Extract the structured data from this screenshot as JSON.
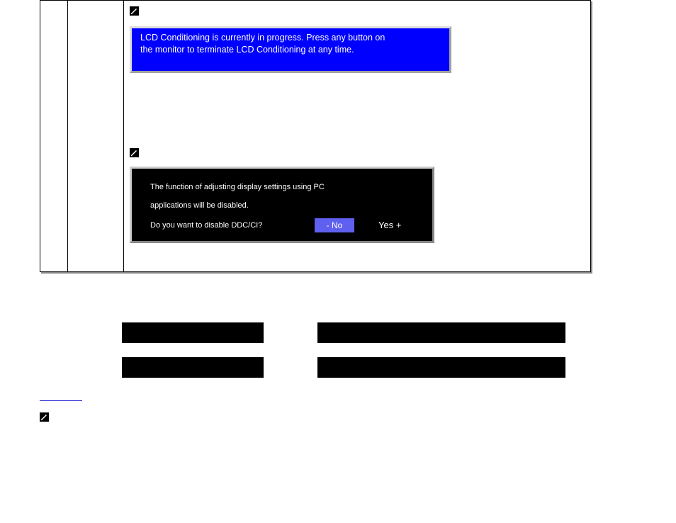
{
  "blue_message": {
    "line1": "LCD Conditioning is currently in progress.  Press any button on",
    "line2": "the monitor to terminate LCD Conditioning at any time."
  },
  "ddc_dialog": {
    "line1": "The function of adjusting display settings using PC",
    "line2": "applications will be disabled.",
    "question": "Do you want to disable DDC/CI?",
    "no_label": "- No",
    "yes_label": "Yes +"
  },
  "icon_names": {
    "pencil": "note-icon",
    "pencil2": "note-icon",
    "pencil3": "note-icon"
  },
  "link_text": " "
}
